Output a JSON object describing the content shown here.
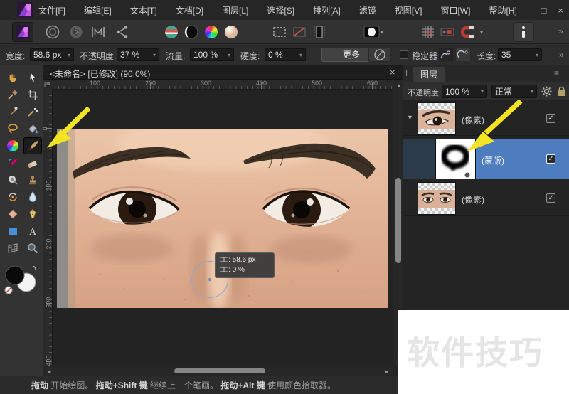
{
  "menu_bar": {
    "items": [
      "文件[F]",
      "编辑[E]",
      "文本[T]",
      "文档[D]",
      "图层[L]",
      "选择[S]",
      "排列[A]",
      "滤镜",
      "视图[V]",
      "窗口[W]",
      "帮助[H]"
    ]
  },
  "toolbar": {
    "icon_names": [
      "affinity-logo",
      "liquify-persona",
      "develop-persona",
      "tone-mapping-persona",
      "export-persona",
      "auto-levels",
      "auto-contrast",
      "auto-colors",
      "auto-white-balance",
      "selection-new",
      "selection-subtract",
      "selection-column",
      "mask-preview",
      "grid-options",
      "assistant-options",
      "snapping-magnet",
      "assistant-info"
    ],
    "overflow": "»"
  },
  "options_bar": {
    "width_label": "宽度:",
    "width_value": "58.6 px",
    "opacity_label": "不透明度:",
    "opacity_value": "37 %",
    "flow_label": "流量:",
    "flow_value": "100 %",
    "hardness_label": "硬度:",
    "hardness_value": "0 %",
    "more_button": "更多",
    "stabilizer_label": "稳定器",
    "length_label": "长度:",
    "length_value": "35",
    "overflow": "»"
  },
  "tools_panel": {
    "tools": [
      "view",
      "move",
      "color-picker",
      "crop",
      "selection-brush",
      "flood-select",
      "lasso",
      "flood-fill",
      "gradient",
      "paint-brush",
      "color-replacement-brush",
      "erase",
      "dodge",
      "clone",
      "sponge",
      "blur",
      "healing",
      "pen",
      "shape",
      "text",
      "mesh-warp",
      "zoom"
    ],
    "selected_tool": "paint-brush"
  },
  "document": {
    "tab_title": "<未命名> [已修改] (90.0%)"
  },
  "rulers": {
    "unit": "px",
    "horizontal": [
      "100",
      "200",
      "300",
      "400",
      "500",
      "600"
    ],
    "vertical": [
      "0",
      "100",
      "200",
      "300",
      "400"
    ]
  },
  "brush_tooltip": {
    "line1": "□□: 58.6 px",
    "line2": "□□: 0 %"
  },
  "layers_panel": {
    "tab_label": "图层",
    "opacity_label": "不透明度:",
    "opacity_value": "100 %",
    "blend_mode": "正常",
    "rows": [
      {
        "label": "(像素)",
        "checked": true
      },
      {
        "label": "(蒙版)",
        "checked": true,
        "selected": true
      },
      {
        "label": "(像素)",
        "checked": true
      }
    ]
  },
  "status_bar": {
    "drag1": "拖动",
    "text1": " 开始绘图。 ",
    "drag2": "拖动+Shift 键",
    "text2": " 继续上一个笔画。 ",
    "drag3": "拖动+Alt 键",
    "text3": " 使用颜色拾取器。"
  },
  "watermark": {
    "text": "软件技巧"
  },
  "icons": {
    "check": "✓",
    "dropdown": "▾",
    "expand": "▼",
    "close": "×",
    "minimize": "–",
    "maximize": "□",
    "overflow": "»",
    "menu": "≡",
    "pin": "‖",
    "up": "▲",
    "down": "▼",
    "left": "◄",
    "right": "►"
  },
  "colors": {
    "selected_layer_blue": "#4d7dbe",
    "annotation_arrow_yellow": "#f3e324",
    "brush_cursor_blue": "#8fa6cc"
  }
}
